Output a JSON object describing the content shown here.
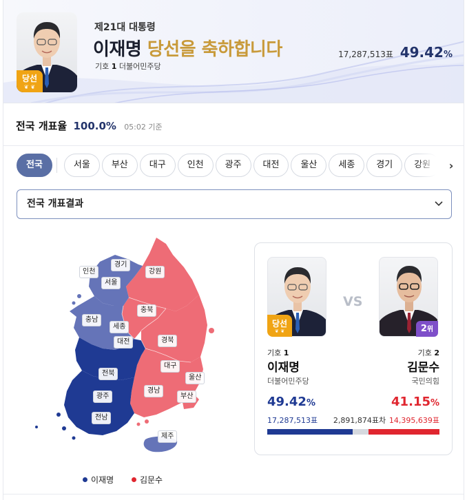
{
  "banner": {
    "election": "제21대 대통령",
    "winner_name": "이재명",
    "congrats": "당선을 축하합니다",
    "symbol_prefix": "기호",
    "symbol_no": "1",
    "party": "더불어민주당",
    "votes": "17,287,513표",
    "pct": "49.42",
    "pct_unit": "%",
    "badge": "당선"
  },
  "count": {
    "label": "전국 개표율",
    "value": "100.0",
    "unit": "%",
    "time": "05:02 기준"
  },
  "regions": [
    "전국",
    "서울",
    "부산",
    "대구",
    "인천",
    "광주",
    "대전",
    "울산",
    "세종",
    "경기",
    "강원"
  ],
  "select": {
    "value": "전국 개표결과"
  },
  "map": {
    "labels": {
      "gyeonggi": "경기",
      "incheon": "인천",
      "seoul": "서울",
      "gangwon": "강원",
      "chungbuk": "충북",
      "chungnam": "충남",
      "sejong": "세종",
      "daejeon": "대전",
      "gyeongbuk": "경북",
      "daegu": "대구",
      "ulsan": "울산",
      "jeonbuk": "전북",
      "gyeongnam": "경남",
      "busan": "부산",
      "gwangju": "광주",
      "jeonnam": "전남",
      "jeju": "제주"
    }
  },
  "legend": [
    {
      "name": "이재명",
      "color": "#1f3a93"
    },
    {
      "name": "김문수",
      "color": "#e0262f"
    }
  ],
  "compare": {
    "vs": "VS",
    "left": {
      "symbol_prefix": "기호",
      "symbol_no": "1",
      "name": "이재명",
      "party": "더불어민주당",
      "pct": "49.42",
      "pct_unit": "%",
      "votes": "17,287,513표",
      "badge": "당선"
    },
    "right": {
      "symbol_prefix": "기호",
      "symbol_no": "2",
      "name": "김문수",
      "party": "국민의힘",
      "pct": "41.15",
      "pct_unit": "%",
      "votes": "14,395,639표",
      "rank": "2",
      "rank_unit": "위"
    },
    "gap": "2,891,874표차",
    "bar_share": {
      "left": 49.42,
      "other": 9.43,
      "right": 41.15
    }
  },
  "colors": {
    "lee_blue": "#1f3a93",
    "lee_light": "#6574b8",
    "kim_red": "#e0262f",
    "kim_light": "#ee6c76",
    "gold": "#c89a3a",
    "chip_active": "#5a6fa5"
  }
}
